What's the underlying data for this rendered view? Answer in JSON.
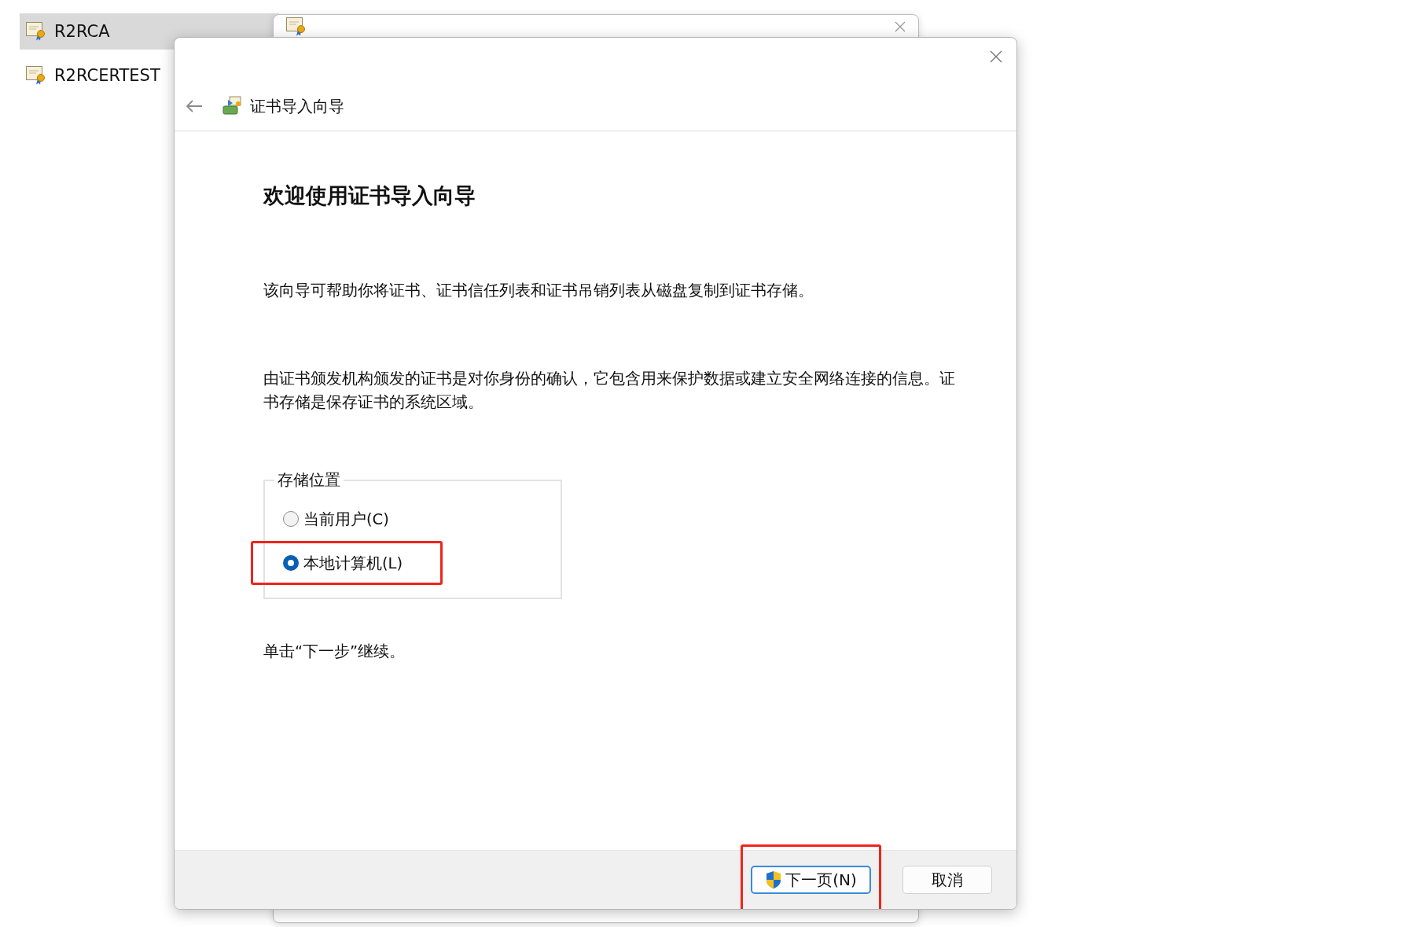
{
  "file_list": {
    "items": [
      {
        "label": "R2RCA",
        "selected": true
      },
      {
        "label": "R2RCERTEST",
        "selected": false
      }
    ]
  },
  "dialog": {
    "title": "证书导入向导",
    "heading": "欢迎使用证书导入向导",
    "paragraphs": [
      "该向导可帮助你将证书、证书信任列表和证书吊销列表从磁盘复制到证书存储。",
      "由证书颁发机构颁发的证书是对你身份的确认，它包含用来保护数据或建立安全网络连接的信息。证书存储是保存证书的系统区域。"
    ],
    "storage_location": {
      "label": "存储位置",
      "options": [
        {
          "label": "当前用户(C)",
          "selected": false,
          "highlighted": false
        },
        {
          "label": "本地计算机(L)",
          "selected": true,
          "highlighted": true
        }
      ]
    },
    "hint": "单击“下一步”继续。",
    "buttons": [
      {
        "label": "下一页(N)",
        "kind": "primary",
        "highlighted": true
      },
      {
        "label": "取消",
        "kind": "default",
        "highlighted": false
      }
    ]
  }
}
